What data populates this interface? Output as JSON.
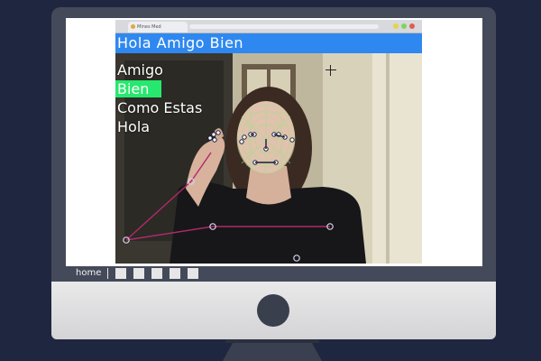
{
  "app": {
    "tab_title": "Mines Med",
    "caption_text": "Hola Amigo Bien",
    "accent_color": "#2f88f0",
    "highlight_color": "#27e86e",
    "window_dots": [
      "#e7d24a",
      "#7dd65c",
      "#e55a4e"
    ]
  },
  "word_list": [
    {
      "text": "Amigo",
      "highlighted": false
    },
    {
      "text": "Bien",
      "highlighted": true
    },
    {
      "text": "Como Estas",
      "highlighted": false
    },
    {
      "text": "Hola",
      "highlighted": false
    }
  ],
  "taskbar": {
    "home_label": "home",
    "separator": "|",
    "tiles": [
      "app-tile-1",
      "app-tile-2",
      "app-tile-3",
      "app-tile-4",
      "app-tile-5"
    ]
  },
  "overlay": {
    "crosshair_icon": "crosshair-icon",
    "pose_color": "#b02a6a",
    "face_mesh_color": "#9fe08a"
  }
}
